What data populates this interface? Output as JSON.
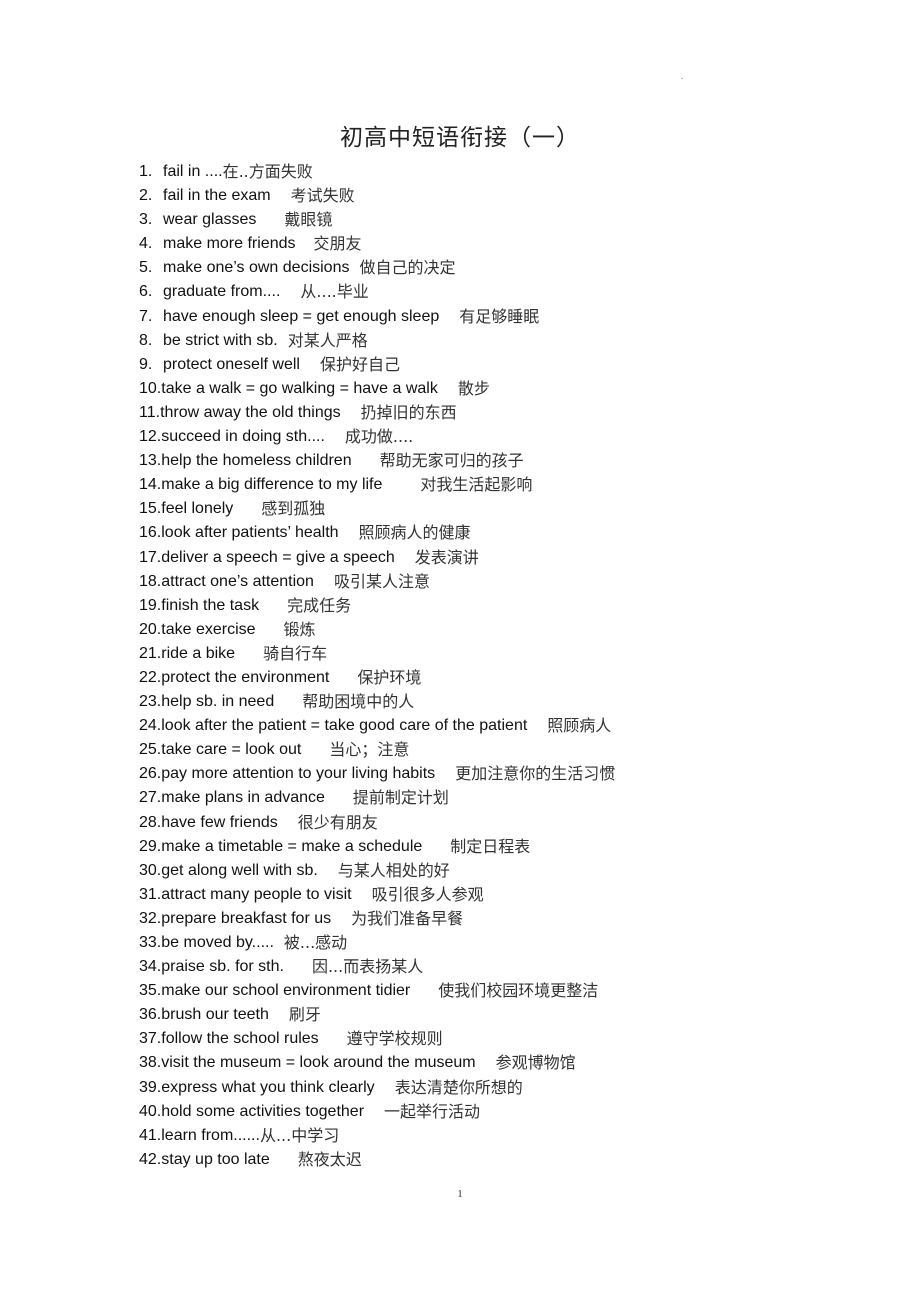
{
  "document": {
    "title": "初高中短语衔接（一）",
    "page_number": "1",
    "items": [
      {
        "num": "1.",
        "en": "fail in ....",
        "zh": "在..方面失败",
        "gap": 0
      },
      {
        "num": "2.",
        "en": "fail in the exam",
        "zh": "考试失败",
        "gap": 20
      },
      {
        "num": "3.",
        "en": "wear glasses",
        "zh": "戴眼镜",
        "gap": 28
      },
      {
        "num": "4.",
        "en": "make more friends",
        "zh": "交朋友",
        "gap": 18
      },
      {
        "num": "5.",
        "en": "make one’s own decisions",
        "zh": "做自己的决定",
        "gap": 10
      },
      {
        "num": "6.",
        "en": "graduate from....",
        "zh": "从....毕业",
        "gap": 20
      },
      {
        "num": "7.",
        "en": "have enough sleep = get enough sleep",
        "zh": "有足够睡眠",
        "gap": 20
      },
      {
        "num": "8.",
        "en": "be strict with sb.",
        "zh": "对某人严格",
        "gap": 10
      },
      {
        "num": "9.",
        "en": "protect oneself well",
        "zh": "保护好自己",
        "gap": 20
      },
      {
        "num": "10.",
        "en": "take a walk = go walking = have a walk",
        "zh": "散步",
        "gap": 20
      },
      {
        "num": "11.",
        "en": "throw away the old things",
        "zh": "扔掉旧的东西",
        "gap": 20
      },
      {
        "num": "12.",
        "en": "succeed in doing sth....",
        "zh": "成功做....",
        "gap": 20
      },
      {
        "num": "13.",
        "en": "help the homeless children",
        "zh": "帮助无家可归的孩子",
        "gap": 28
      },
      {
        "num": "14.",
        "en": "make a big difference to my life",
        "zh": "对我生活起影响",
        "gap": 38
      },
      {
        "num": "15.",
        "en": "feel lonely",
        "zh": "感到孤独",
        "gap": 28
      },
      {
        "num": "16.",
        "en": "look after patients’ health",
        "zh": "照顾病人的健康",
        "gap": 20
      },
      {
        "num": "17.",
        "en": "deliver a speech = give a speech",
        "zh": "发表演讲",
        "gap": 20
      },
      {
        "num": "18.",
        "en": "attract one’s attention",
        "zh": "吸引某人注意",
        "gap": 20
      },
      {
        "num": "19.",
        "en": "finish the task",
        "zh": "完成任务",
        "gap": 28
      },
      {
        "num": "20.",
        "en": "take exercise",
        "zh": "锻炼",
        "gap": 28
      },
      {
        "num": "21.",
        "en": "ride a bike",
        "zh": "骑自行车",
        "gap": 28
      },
      {
        "num": "22.",
        "en": "protect the environment",
        "zh": "保护环境",
        "gap": 28
      },
      {
        "num": "23.",
        "en": "help sb. in need",
        "zh": "帮助困境中的人",
        "gap": 28
      },
      {
        "num": "24.",
        "en": "look after the patient = take good care of the patient",
        "zh": "照顾病人",
        "gap": 20
      },
      {
        "num": "25.",
        "en": "take care = look out",
        "zh": "当心；注意",
        "gap": 28
      },
      {
        "num": "26.",
        "en": "pay more attention to your living habits",
        "zh": "更加注意你的生活习惯",
        "gap": 20
      },
      {
        "num": "27.",
        "en": "make plans in advance",
        "zh": "提前制定计划",
        "gap": 28
      },
      {
        "num": "28.",
        "en": "have few friends",
        "zh": "很少有朋友",
        "gap": 20
      },
      {
        "num": "29.",
        "en": "make a timetable = make a schedule",
        "zh": "制定日程表",
        "gap": 28
      },
      {
        "num": "30.",
        "en": "get along well with sb.",
        "zh": "与某人相处的好",
        "gap": 20
      },
      {
        "num": "31.",
        "en": "attract many people to visit",
        "zh": "吸引很多人参观",
        "gap": 20
      },
      {
        "num": "32.",
        "en": "prepare breakfast for us",
        "zh": "为我们准备早餐",
        "gap": 20
      },
      {
        "num": "33.",
        "en": "be moved by.....",
        "zh": "被...感动",
        "gap": 10
      },
      {
        "num": "34.",
        "en": "praise sb. for sth.",
        "zh": "因...而表扬某人",
        "gap": 28
      },
      {
        "num": "35.",
        "en": "make our school environment tidier",
        "zh": "使我们校园环境更整洁",
        "gap": 28
      },
      {
        "num": "36.",
        "en": "brush our teeth",
        "zh": "刷牙",
        "gap": 20
      },
      {
        "num": "37.",
        "en": "follow the school rules",
        "zh": "遵守学校规则",
        "gap": 28
      },
      {
        "num": "38.",
        "en": "visit the museum = look around the museum",
        "zh": "参观博物馆",
        "gap": 20
      },
      {
        "num": "39.",
        "en": "express what you think clearly",
        "zh": "表达清楚你所想的",
        "gap": 20
      },
      {
        "num": "40.",
        "en": "hold some activities together",
        "zh": "一起举行活动",
        "gap": 20
      },
      {
        "num": "41.",
        "en": "learn from......",
        "zh": "从...中学习",
        "gap": 0
      },
      {
        "num": "42.",
        "en": "stay up too late",
        "zh": "熬夜太迟",
        "gap": 28
      }
    ]
  }
}
